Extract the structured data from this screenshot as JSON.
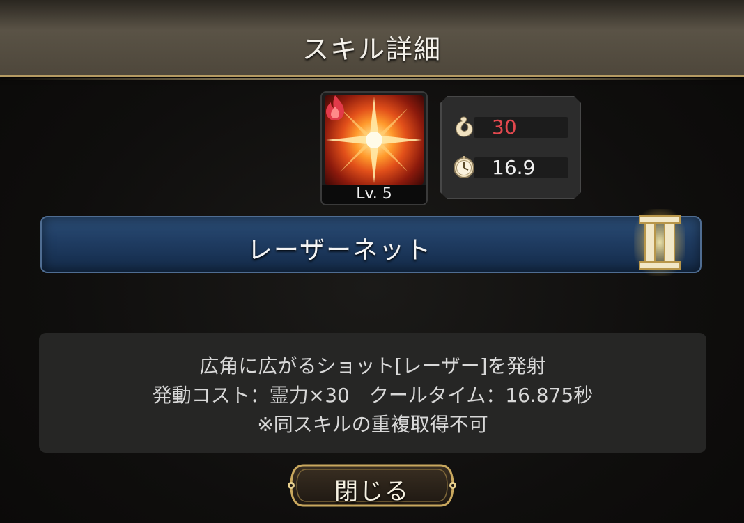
{
  "header": {
    "title": "スキル詳細"
  },
  "skill": {
    "level_label": "Lv. 5",
    "element_icon": "fire-icon",
    "name": "レーザーネット",
    "rank": "II"
  },
  "stats": {
    "cost": {
      "icon": "spirit-power-icon",
      "value": "30"
    },
    "cooldown": {
      "icon": "clock-icon",
      "value": "16.9"
    }
  },
  "description": {
    "lines": [
      "広角に広がるショット[レーザー]を発射",
      "発動コスト：霊力×30　クールタイム：16.875秒",
      "※同スキルの重複取得不可"
    ]
  },
  "buttons": {
    "close_label": "閉じる"
  },
  "colors": {
    "accent_gold": "#d8c08a",
    "cost_red": "#e2484e",
    "banner_blue": "#1f3c62"
  }
}
